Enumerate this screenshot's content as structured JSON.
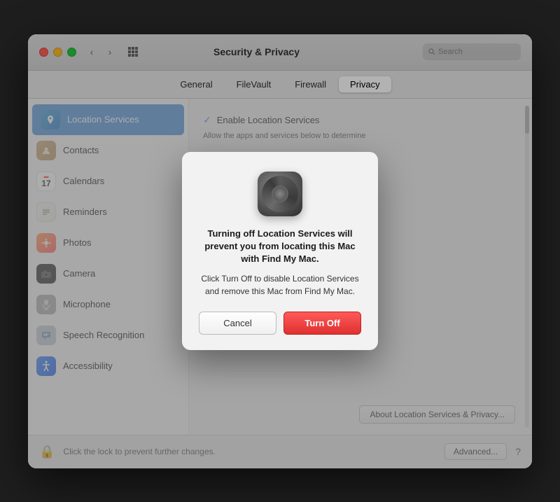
{
  "window": {
    "title": "Security & Privacy"
  },
  "titlebar": {
    "back_label": "‹",
    "forward_label": "›",
    "grid_label": "⊞",
    "search_placeholder": "Search"
  },
  "tabs": [
    {
      "id": "general",
      "label": "General",
      "active": false
    },
    {
      "id": "filevault",
      "label": "FileVault",
      "active": false
    },
    {
      "id": "firewall",
      "label": "Firewall",
      "active": false
    },
    {
      "id": "privacy",
      "label": "Privacy",
      "active": true
    }
  ],
  "sidebar": {
    "items": [
      {
        "id": "location",
        "label": "Location Services",
        "icon": "📍",
        "active": true
      },
      {
        "id": "contacts",
        "label": "Contacts",
        "icon": "👤",
        "active": false
      },
      {
        "id": "calendars",
        "label": "Calendars",
        "icon": "cal",
        "active": false
      },
      {
        "id": "reminders",
        "label": "Reminders",
        "icon": "≡",
        "active": false
      },
      {
        "id": "photos",
        "label": "Photos",
        "icon": "🌸",
        "active": false
      },
      {
        "id": "camera",
        "label": "Camera",
        "icon": "📷",
        "active": false
      },
      {
        "id": "microphone",
        "label": "Microphone",
        "icon": "🎤",
        "active": false
      },
      {
        "id": "speech",
        "label": "Speech Recognition",
        "icon": "🎙",
        "active": false
      },
      {
        "id": "accessibility",
        "label": "Accessibility",
        "icon": "♿",
        "active": false
      }
    ]
  },
  "right_panel": {
    "enable_label": "Enable Location Services",
    "sub_text": "Allow the apps and services below to determine",
    "about_btn": "About Location Services & Privacy..."
  },
  "bottom_bar": {
    "lock_text": "Click the lock to prevent further changes.",
    "advanced_label": "Advanced...",
    "help_label": "?"
  },
  "modal": {
    "title": "Turning off Location Services will prevent you from locating this Mac with Find My Mac.",
    "body": "Click Turn Off to disable Location Services and remove this Mac from Find My Mac.",
    "cancel_label": "Cancel",
    "turnoff_label": "Turn Off"
  }
}
